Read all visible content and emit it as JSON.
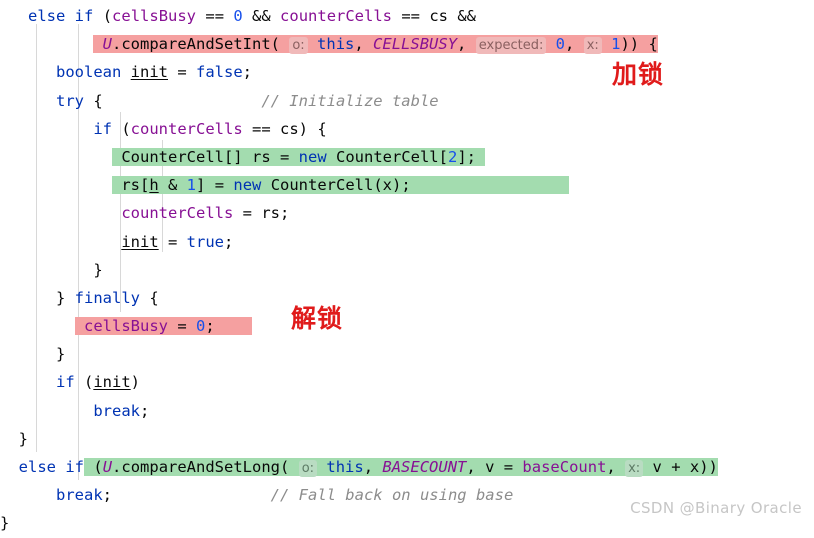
{
  "editor": {
    "language": "java",
    "theme": "IntelliJ Light",
    "colors": {
      "keyword": "#0033b3",
      "field": "#871094",
      "number": "#1750eb",
      "comment": "#8c8c8c",
      "text": "#080808",
      "highlight_red": "#f5a0a0",
      "highlight_green": "#a3dcaf",
      "annotation_red": "#e01b1b",
      "watermark": "#c6c6c6",
      "indent_guide": "#d8d8d8",
      "inlay_hint": "#8c8c8c"
    }
  },
  "code": {
    "line01": {
      "kw_else": "else",
      "kw_if": "if",
      "paren": "(",
      "field_cellsBusy": "cellsBusy",
      "op_eq1": " == ",
      "num_0": "0",
      "op_and": " && ",
      "field_counterCells": "counterCells",
      "op_eq2": " == ",
      "var_cs": "cs",
      "op_and2": " &&"
    },
    "line02": {
      "cls_U": "U",
      "dot_method": ".compareAndSetInt(",
      "hint_o": "o:",
      "kw_this": "this",
      "comma1": ",",
      "const_CELLSBUSY": "CELLSBUSY",
      "comma2": ",",
      "hint_expected": "expected:",
      "num_0": "0",
      "comma3": ",",
      "hint_x": "x:",
      "num_1": "1",
      "tail": ")) {"
    },
    "line03": {
      "kw_boolean": "boolean",
      "var_init": "init",
      "op_assign": " = ",
      "kw_false": "false",
      "semi": ";"
    },
    "line04": {
      "kw_try": "try",
      "brace": " {",
      "comment": "// Initialize table"
    },
    "line05": {
      "kw_if": "if",
      "paren": " (",
      "field_counterCells": "counterCells",
      "op_eq": " == ",
      "var_cs": "cs",
      "tail": ") {"
    },
    "line06": {
      "cls_CounterCell": "CounterCell[]",
      "var_rs": " rs",
      "op_assign": " = ",
      "kw_new": "new",
      "cls_CounterCell2": " CounterCell[",
      "num_2": "2",
      "tail": "];"
    },
    "line07": {
      "var_rs": "rs[",
      "var_h": "h",
      "op_and": " & ",
      "num_1": "1",
      "close": "]",
      "op_assign": " = ",
      "kw_new": "new",
      "cls_CounterCell": " CounterCell(x);"
    },
    "line08": {
      "field_counterCells": "counterCells",
      "op_assign": " = ",
      "var_rs": "rs",
      "semi": ";"
    },
    "line09": {
      "var_init": "init",
      "op_assign": " = ",
      "kw_true": "true",
      "semi": ";"
    },
    "line10": {
      "brace": "}"
    },
    "line11": {
      "brace_close": "} ",
      "kw_finally": "finally",
      "brace_open": " {"
    },
    "line12": {
      "field_cellsBusy": "cellsBusy",
      "op_assign": " = ",
      "num_0": "0",
      "semi": ";"
    },
    "line13": {
      "brace": "}"
    },
    "line14": {
      "kw_if": "if",
      "paren": " (",
      "var_init": "init",
      "close": ")"
    },
    "line15": {
      "kw_break": "break",
      "semi": ";"
    },
    "line16": {
      "brace": "}"
    },
    "line17": {
      "kw_else": "else",
      "kw_if": "if",
      "paren": " (",
      "cls_U": "U",
      "method": ".compareAndSetLong(",
      "hint_o": "o:",
      "kw_this": "this",
      "comma1": ",",
      "const_BASECOUNT": "BASECOUNT",
      "comma2": ",",
      "var_v": "v",
      "op_assign": " = ",
      "field_baseCount": "baseCount",
      "comma3": ",",
      "hint_x": "x:",
      "expr": "v + x",
      "tail": "))"
    },
    "line18": {
      "kw_break": "break",
      "semi": ";",
      "comment": "// Fall back on using base"
    },
    "line19": {
      "brace": "}"
    }
  },
  "annotations": {
    "lock": "加锁",
    "unlock": "解锁"
  },
  "watermark": {
    "text": "CSDN @Binary Oracle"
  }
}
